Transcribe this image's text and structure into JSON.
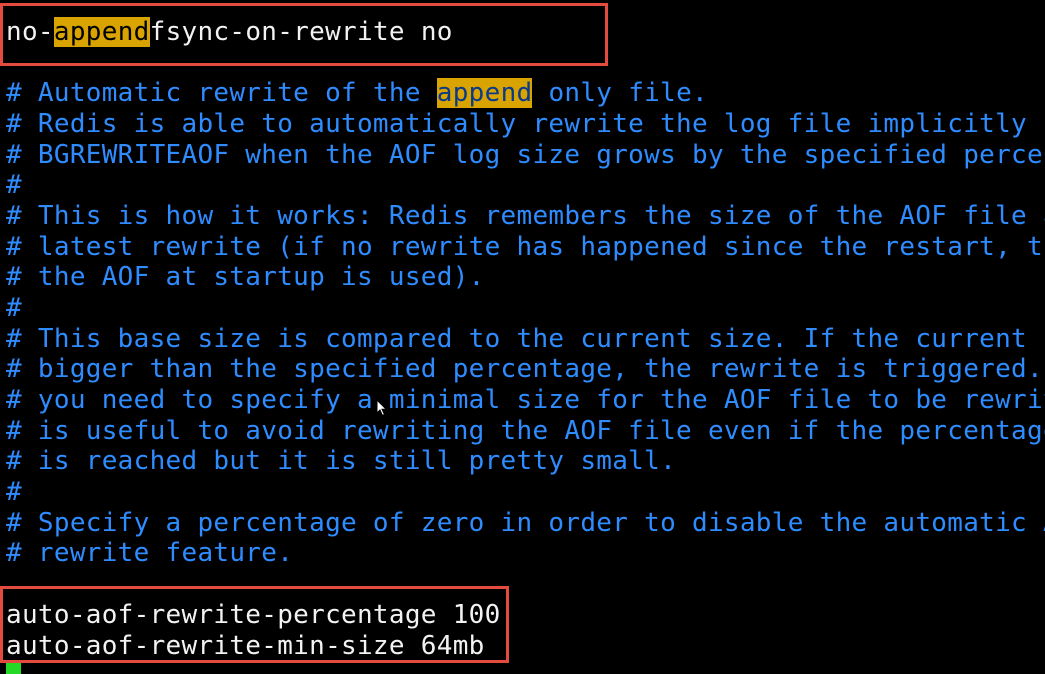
{
  "terminal": {
    "top_line": {
      "prefix": "no-",
      "highlight": "append",
      "suffix": "fsync-on-rewrite no"
    },
    "comment_first": {
      "prefix": "# Automatic rewrite of the ",
      "highlight": "append",
      "suffix": " only file."
    },
    "comments": [
      "# Redis is able to automatically rewrite the log file implicitly c",
      "# BGREWRITEAOF when the AOF log size grows by the specified percen",
      "#",
      "# This is how it works: Redis remembers the size of the AOF file a",
      "# latest rewrite (if no rewrite has happened since the restart, th",
      "# the AOF at startup is used).",
      "#",
      "# This base size is compared to the current size. If the current s",
      "# bigger than the specified percentage, the rewrite is triggered.",
      "# you need to specify a minimal size for the AOF file to be rewrit",
      "# is useful to avoid rewriting the AOF file even if the percentage",
      "# is reached but it is still pretty small.",
      "#",
      "# Specify a percentage of zero in order to disable the automatic A",
      "# rewrite feature."
    ],
    "config_lines": [
      "auto-aof-rewrite-percentage 100",
      "auto-aof-rewrite-min-size 64mb"
    ]
  },
  "colors": {
    "background": "#000000",
    "comment": "#2f8cff",
    "config_text": "#f2f2f2",
    "search_highlight": "#d9a400",
    "annotation_box": "#e34b3e",
    "cursor": "#27d927"
  },
  "icons": {
    "mouse_pointer": "mouse-pointer-icon",
    "cursor": "terminal-cursor"
  }
}
